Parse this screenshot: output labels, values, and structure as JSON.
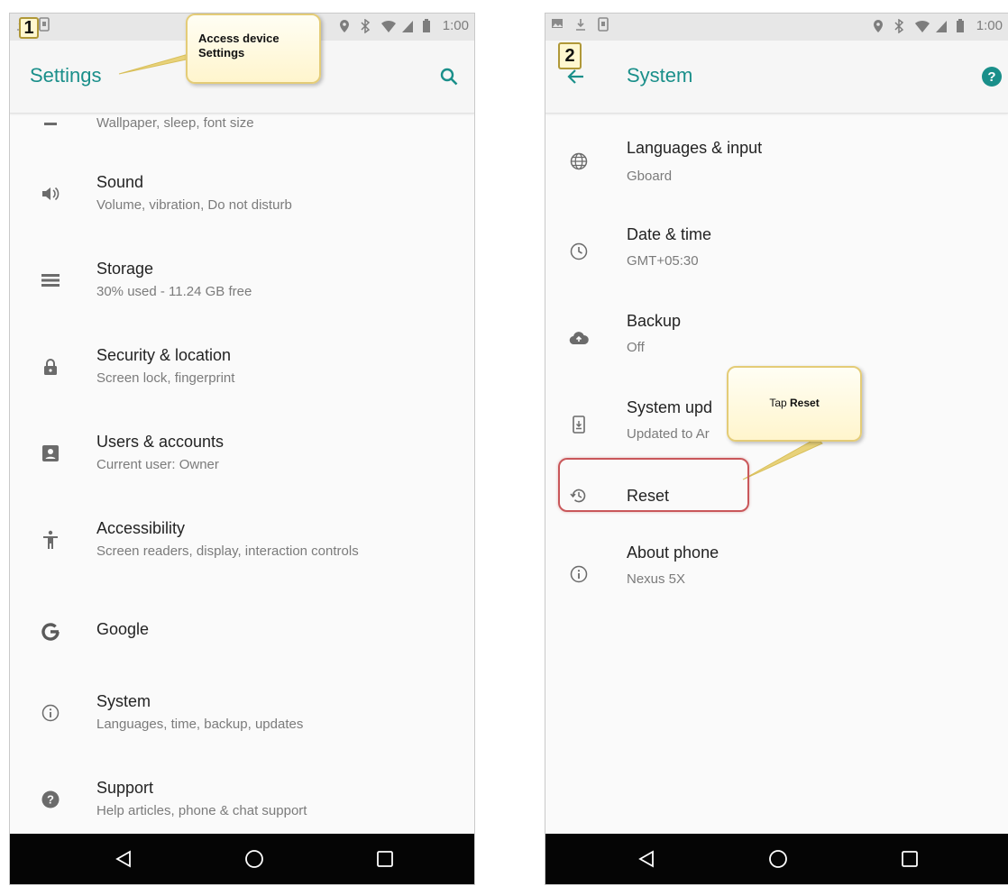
{
  "step1": {
    "number": "1",
    "callout": "Access device Settings",
    "callout_line1": "Access device",
    "callout_line2": "Settings",
    "status_time": "1:00",
    "appbar": {
      "title": "Settings",
      "action_icon": "search-icon"
    },
    "items": [
      {
        "icon": "display-icon",
        "title": "",
        "subtitle": "Wallpaper, sleep, font size"
      },
      {
        "icon": "volume-icon",
        "title": "Sound",
        "subtitle": "Volume, vibration, Do not disturb"
      },
      {
        "icon": "storage-icon",
        "title": "Storage",
        "subtitle": "30% used - 11.24 GB free"
      },
      {
        "icon": "lock-icon",
        "title": "Security & location",
        "subtitle": "Screen lock, fingerprint"
      },
      {
        "icon": "account-icon",
        "title": "Users & accounts",
        "subtitle": "Current user: Owner"
      },
      {
        "icon": "accessibility-icon",
        "title": "Accessibility",
        "subtitle": "Screen readers, display, interaction controls"
      },
      {
        "icon": "google-icon",
        "title": "Google",
        "subtitle": ""
      },
      {
        "icon": "info-icon",
        "title": "System",
        "subtitle": "Languages, time, backup, updates"
      },
      {
        "icon": "help-icon",
        "title": "Support",
        "subtitle": "Help articles, phone & chat support"
      }
    ]
  },
  "step2": {
    "number": "2",
    "callout_prefix": "Tap ",
    "callout_bold": "Reset",
    "status_time": "1:00",
    "appbar": {
      "title": "System",
      "back_icon": "back-arrow-icon",
      "action_icon": "help-icon"
    },
    "items": [
      {
        "icon": "globe-icon",
        "title": "Languages & input",
        "subtitle": "Gboard"
      },
      {
        "icon": "clock-icon",
        "title": "Date & time",
        "subtitle": "GMT+05:30"
      },
      {
        "icon": "cloud-upload-icon",
        "title": "Backup",
        "subtitle": "Off"
      },
      {
        "icon": "system-update-icon",
        "title": "System upd",
        "subtitle": "Updated to Ar"
      },
      {
        "icon": "restore-icon",
        "title": "Reset",
        "subtitle": ""
      },
      {
        "icon": "info-icon",
        "title": "About phone",
        "subtitle": "Nexus 5X"
      }
    ]
  },
  "colors": {
    "accent": "#1a8f8a",
    "callout_border": "#e4cc77",
    "highlight": "#c9575a",
    "navbar": "#050505"
  },
  "navbar": {
    "icons": [
      "back-triangle-icon",
      "home-circle-icon",
      "recents-square-icon"
    ]
  }
}
